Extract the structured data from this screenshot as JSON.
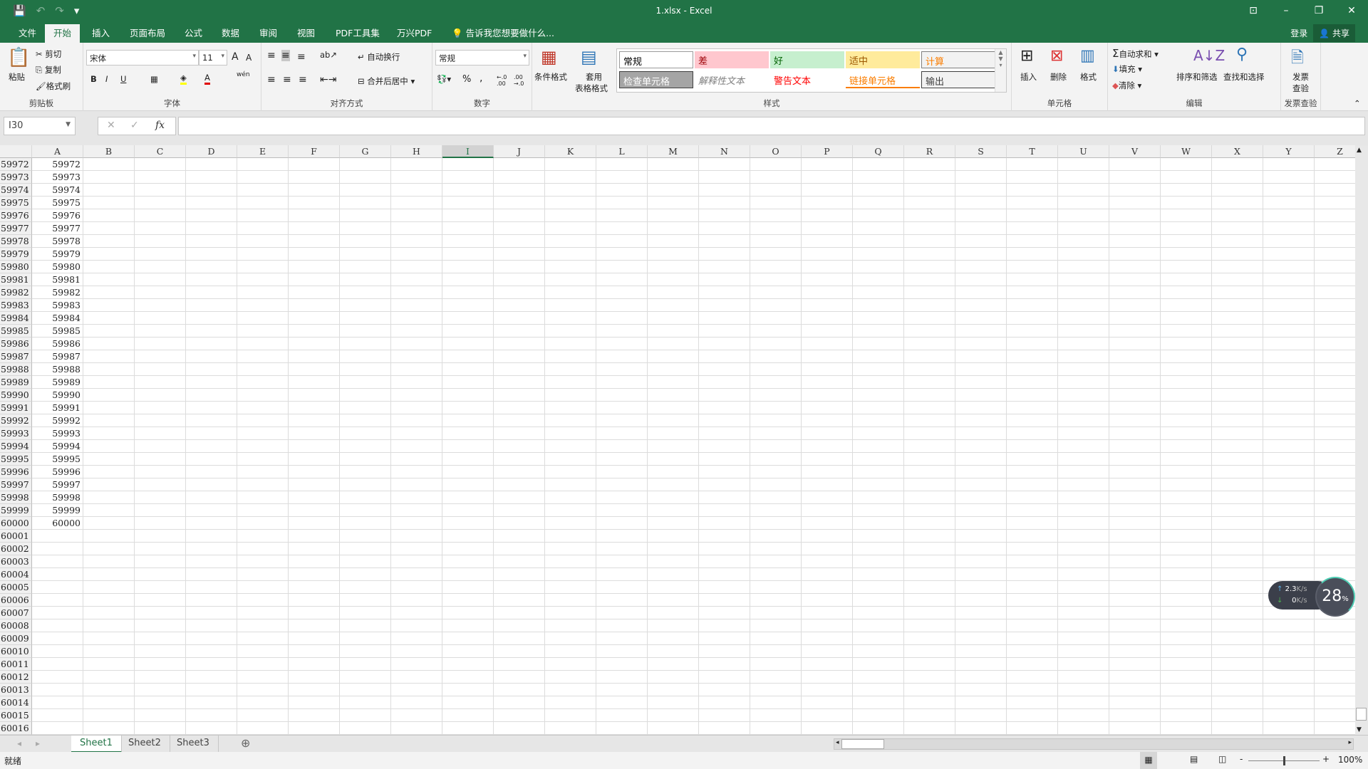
{
  "titlebar": {
    "title": "1.xlsx - Excel",
    "save_icon": "💾",
    "undo_icon": "↶",
    "redo_icon": "↷",
    "customize_icon": "▾",
    "ribbon_display_icon": "⊡",
    "minimize_icon": "–",
    "restore_icon": "❐",
    "close_icon": "✕"
  },
  "tabs": [
    "文件",
    "开始",
    "插入",
    "页面布局",
    "公式",
    "数据",
    "审阅",
    "视图",
    "PDF工具集",
    "万兴PDF"
  ],
  "tell_me": "告诉我您想要做什么...",
  "login": "登录",
  "share": "共享",
  "ribbon": {
    "clipboard": {
      "paste": "粘贴",
      "cut": "剪切",
      "copy": "复制",
      "format_painter": "格式刷",
      "label": "剪贴板"
    },
    "font": {
      "name": "宋体",
      "size": "11",
      "bold": "B",
      "italic": "I",
      "underline": "U",
      "phonetic": "wén",
      "label": "字体",
      "grow": "A",
      "shrink": "A",
      "font_color": "A"
    },
    "align": {
      "wrap": "自动换行",
      "merge": "合并后居中",
      "label": "对齐方式"
    },
    "number": {
      "format": "常规",
      "percent": "%",
      "comma": ",",
      "inc_decimal": "←.0 .00",
      "dec_decimal": ".00 →.0",
      "label": "数字"
    },
    "styles": {
      "cond_format": "条件格式",
      "table_format_1": "套用",
      "table_format_2": "表格格式",
      "label": "样式",
      "gallery": [
        {
          "text": "常规",
          "bg": "#ffffff",
          "fg": "#000000",
          "border": "#9a9a9a"
        },
        {
          "text": "差",
          "bg": "#ffc7ce",
          "fg": "#9c0006",
          "border": ""
        },
        {
          "text": "好",
          "bg": "#c6efce",
          "fg": "#006100",
          "border": ""
        },
        {
          "text": "适中",
          "bg": "#ffeb9c",
          "fg": "#9c5700",
          "border": ""
        },
        {
          "text": "计算",
          "bg": "#f2f2f2",
          "fg": "#fa7d00",
          "border": "#7f7f7f"
        },
        {
          "text": "检查单元格",
          "bg": "#a5a5a5",
          "fg": "#ffffff",
          "border": "#3f3f3f"
        },
        {
          "text": "解释性文本",
          "bg": "#ffffff",
          "fg": "#7f7f7f",
          "border": ""
        },
        {
          "text": "警告文本",
          "bg": "#ffffff",
          "fg": "#ff0000",
          "border": ""
        },
        {
          "text": "链接单元格",
          "bg": "#ffffff",
          "fg": "#fa7d00",
          "border": ""
        },
        {
          "text": "输出",
          "bg": "#f2f2f2",
          "fg": "#3f3f3f",
          "border": "#3f3f3f"
        }
      ]
    },
    "cells": {
      "insert": "插入",
      "delete": "删除",
      "format": "格式",
      "label": "单元格"
    },
    "editing": {
      "autosum": "自动求和",
      "fill": "填充",
      "clear": "清除",
      "sort": "排序和筛选",
      "find": "查找和选择",
      "label": "编辑"
    },
    "invoice": {
      "check_1": "发票",
      "check_2": "查验",
      "label": "发票查验"
    }
  },
  "formula_bar": {
    "name_box": "I30",
    "cancel": "✕",
    "enter": "✓",
    "fx": "fx",
    "value": ""
  },
  "columns": [
    "A",
    "B",
    "C",
    "D",
    "E",
    "F",
    "G",
    "H",
    "I",
    "J",
    "K",
    "L",
    "M",
    "N",
    "O",
    "P",
    "Q",
    "R",
    "S",
    "T",
    "U",
    "V",
    "W",
    "X",
    "Y",
    "Z"
  ],
  "selected_column": "I",
  "rows": [
    59972,
    59973,
    59974,
    59975,
    59976,
    59977,
    59978,
    59979,
    59980,
    59981,
    59982,
    59983,
    59984,
    59985,
    59986,
    59987,
    59988,
    59989,
    59990,
    59991,
    59992,
    59993,
    59994,
    59995,
    59996,
    59997,
    59998,
    59999,
    60000,
    60001,
    60002,
    60003,
    60004,
    60005,
    60006,
    60007,
    60008,
    60009,
    60010,
    60011,
    60012,
    60013,
    60014,
    60015,
    60016
  ],
  "column_a": [
    59972,
    59973,
    59974,
    59975,
    59976,
    59977,
    59978,
    59979,
    59980,
    59981,
    59982,
    59983,
    59984,
    59985,
    59986,
    59987,
    59988,
    59989,
    59990,
    59991,
    59992,
    59993,
    59994,
    59995,
    59996,
    59997,
    59998,
    59999,
    60000
  ],
  "sheets": [
    "Sheet1",
    "Sheet2",
    "Sheet3"
  ],
  "active_sheet": "Sheet1",
  "add_sheet": "⊕",
  "status": {
    "ready": "就绪",
    "zoom": "100%",
    "zoom_level": 100
  },
  "network_widget": {
    "upload": "2.3",
    "upload_unit": "K/s",
    "download": "0",
    "download_unit": "K/s",
    "percent": "28",
    "percent_sign": "%"
  }
}
